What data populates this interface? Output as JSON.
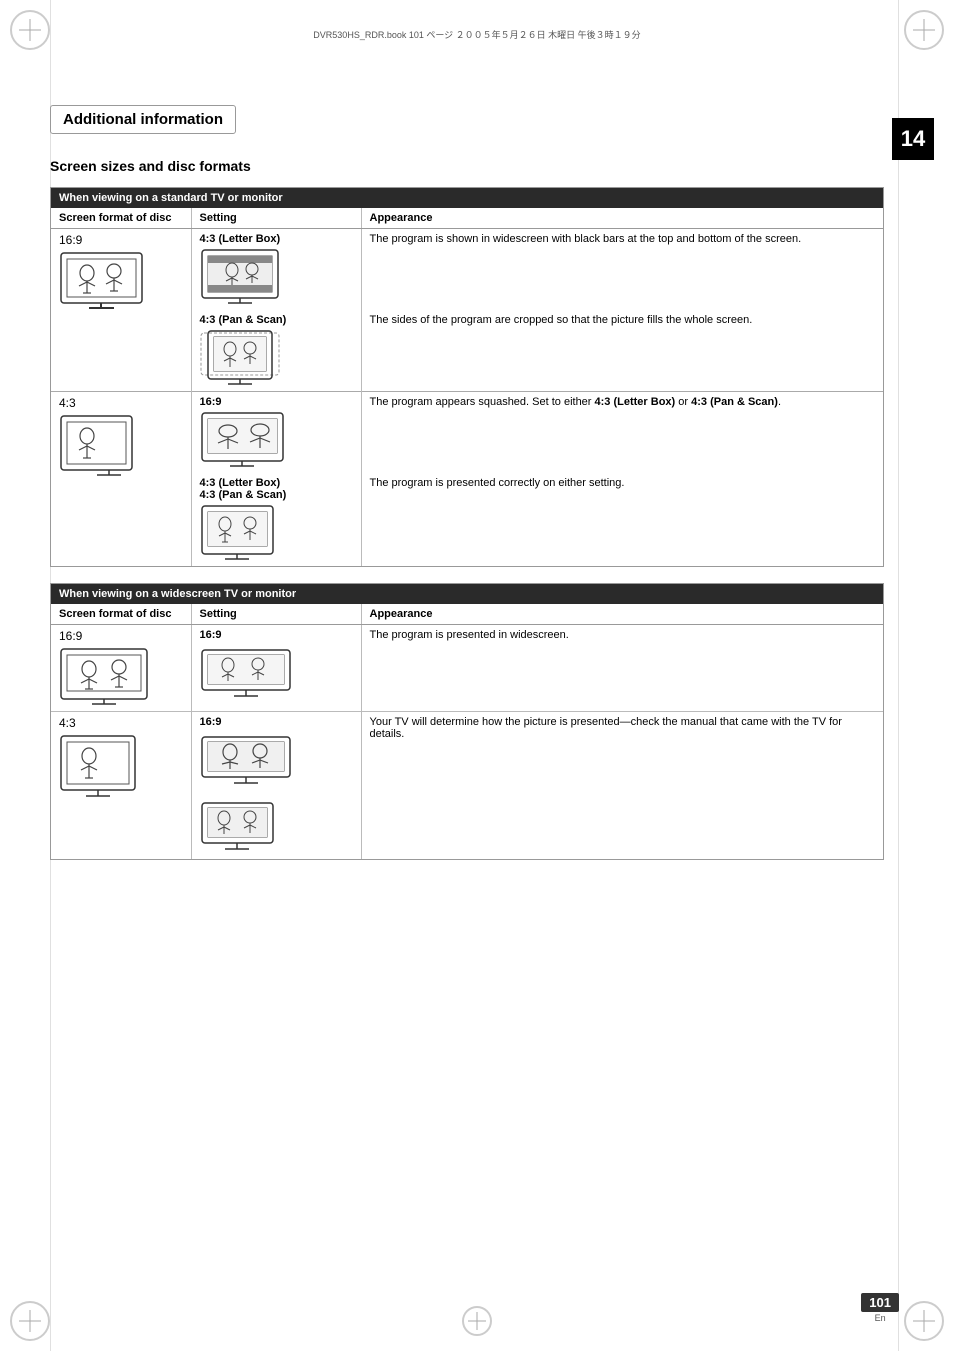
{
  "page": {
    "filepath": "DVR530HS_RDR.book  101 ページ  ２００５年５月２６日  木曜日  午後３時１９分",
    "chapter_number": "14",
    "page_number": "101",
    "page_lang": "En"
  },
  "section": {
    "title": "Additional information",
    "subsection": {
      "heading": "Screen sizes and disc formats",
      "table_standard": {
        "header": "When viewing on a standard TV or monitor",
        "columns": [
          "Screen format of disc",
          "Setting",
          "Appearance"
        ],
        "rows": [
          {
            "disc_format": "16:9",
            "settings": [
              {
                "label": "4:3 (Letter Box)",
                "appearance": "The program is shown in widescreen with black bars at the top and bottom of the screen.",
                "tv_type": "letterbox"
              },
              {
                "label": "4:3 (Pan & Scan)",
                "appearance": "The sides of the program are cropped so that the picture fills the whole screen.",
                "tv_type": "panscan"
              }
            ]
          },
          {
            "disc_format": "4:3",
            "settings": [
              {
                "label": "16:9",
                "appearance": "The program appears squashed. Set to either 4:3 (Letter Box) or 4:3 (Pan & Scan).",
                "tv_type": "squashed",
                "appearance_bold_parts": [
                  "4:3 (Letter Box)",
                  "4:3 (Pan & Scan)"
                ]
              },
              {
                "label": "4:3 (Letter Box)\n4:3 (Pan & Scan)",
                "appearance": "The program is presented correctly on either setting.",
                "tv_type": "correct"
              }
            ]
          }
        ]
      },
      "table_widescreen": {
        "header": "When viewing on a widescreen TV or monitor",
        "columns": [
          "Screen format of disc",
          "Setting",
          "Appearance"
        ],
        "rows": [
          {
            "disc_format": "16:9",
            "settings": [
              {
                "label": "16:9",
                "appearance": "The program is presented in widescreen.",
                "tv_type": "widescreen_wide"
              }
            ]
          },
          {
            "disc_format": "4:3",
            "settings": [
              {
                "label": "16:9",
                "appearance": "Your TV will determine how the picture is presented—check the manual that came with the TV for details.",
                "tv_type": "43_wide_top"
              },
              {
                "label": "",
                "appearance": "",
                "tv_type": "43_wide_bottom"
              }
            ]
          }
        ]
      }
    }
  }
}
